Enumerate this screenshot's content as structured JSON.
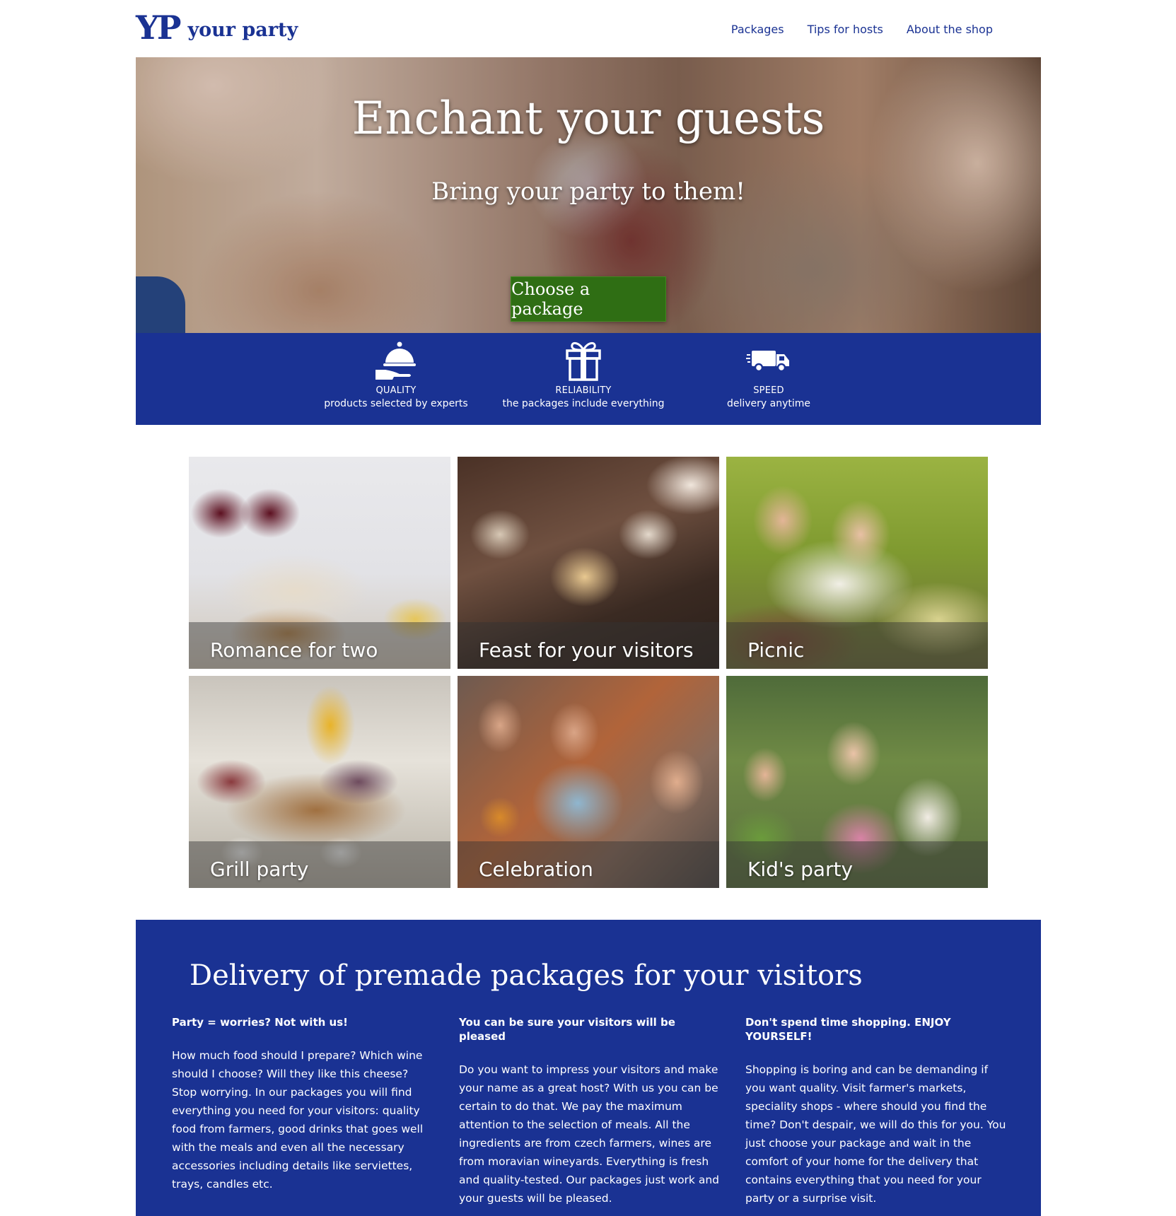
{
  "header": {
    "logo_mark": "YP",
    "logo_text": "your party",
    "nav": [
      {
        "label": "Packages"
      },
      {
        "label": "Tips for hosts"
      },
      {
        "label": "About the shop"
      }
    ]
  },
  "hero": {
    "title": "Enchant your guests",
    "subtitle": "Bring your party to them!",
    "button_label": "Choose a package"
  },
  "features": [
    {
      "icon": "cloche-icon",
      "title": "QUALITY",
      "subtitle": "products selected by experts"
    },
    {
      "icon": "gift-icon",
      "title": "RELIABILITY",
      "subtitle": "the packages include everything"
    },
    {
      "icon": "delivery-truck-icon",
      "title": "SPEED",
      "subtitle": "delivery anytime"
    }
  ],
  "packages": [
    {
      "label": "Romance for two"
    },
    {
      "label": "Feast for your visitors"
    },
    {
      "label": "Picnic"
    },
    {
      "label": "Grill party"
    },
    {
      "label": "Celebration"
    },
    {
      "label": "Kid's party"
    }
  ],
  "info": {
    "title": "Delivery of premade packages for your visitors",
    "columns": [
      {
        "heading": "Party = worries? Not with us!",
        "text": "How much food should I prepare? Which wine should I choose? Will they like this cheese? Stop worrying. In our packages you will find everything you need for your visitors: quality food from farmers, good drinks that goes well with the meals and even all the necessary accessories including details like serviettes, trays, candles etc."
      },
      {
        "heading": "You can be sure your visitors will be pleased",
        "text": "Do you want to impress your visitors and make your name as a great host? With us you can be certain to do that. We pay the maximum attention to the selection of meals. All the ingredients are from czech farmers, wines are from moravian wineyards. Everything is fresh and quality-tested. Our packages just work and your guests will be pleased."
      },
      {
        "heading": "Don't spend time shopping. ENJOY YOURSELF!",
        "text": "Shopping is boring and can be demanding if you want quality. Visit farmer's markets, speciality shops - where should you find the time? Don't despair, we will do this for you. You just choose your package and wait in the comfort of your home for the delivery that contains everything that you need for your party or a surprise visit."
      }
    ]
  },
  "colors": {
    "brand_blue": "#1a3293",
    "button_green": "#2f6e14",
    "text_white": "#ffffff"
  }
}
